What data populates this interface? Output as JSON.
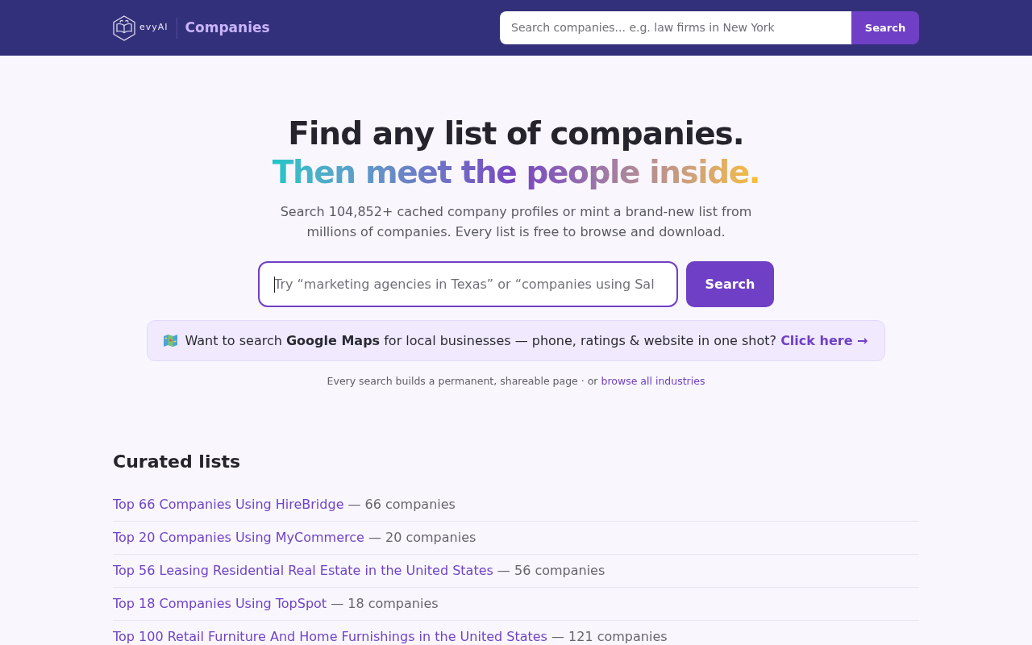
{
  "header": {
    "logo_text": "evyAI",
    "section_title": "Companies",
    "search": {
      "placeholder": "Search companies... e.g. law firms in New York"
    },
    "search_button": "Search"
  },
  "hero": {
    "title_line_1": "Find any list of companies.",
    "title_line_2": "Then meet the people inside.",
    "subtitle": "Search 104,852+ cached company profiles or mint a brand-new list from millions of companies. Every list is free to browse and download.",
    "search": {
      "placeholder": "Try “marketing agencies in Texas” or “companies using Sal",
      "focused": true
    },
    "search_button": "Search"
  },
  "banner": {
    "text": "Want to search **Google Maps** for local businesses — phone, ratings & website in one shot?",
    "link": "Click here →"
  },
  "note": {
    "text": "Every search builds a permanent, shareable page · or",
    "link": "browse all industries"
  },
  "curated_lists": {
    "title": "Curated lists",
    "items": [
      {
        "link": "Top 66 Companies Using HireBridge",
        "count": "— 66 companies"
      },
      {
        "link": "Top 20 Companies Using MyCommerce",
        "count": "— 20 companies"
      },
      {
        "link": "Top 56 Leasing Residential Real Estate in the United States",
        "count": "— 56 companies"
      },
      {
        "link": "Top 18 Companies Using TopSpot",
        "count": "— 18 companies"
      },
      {
        "link": "Top 100 Retail Furniture And Home Furnishings in the United States",
        "count": "— 121 companies"
      }
    ]
  }
}
